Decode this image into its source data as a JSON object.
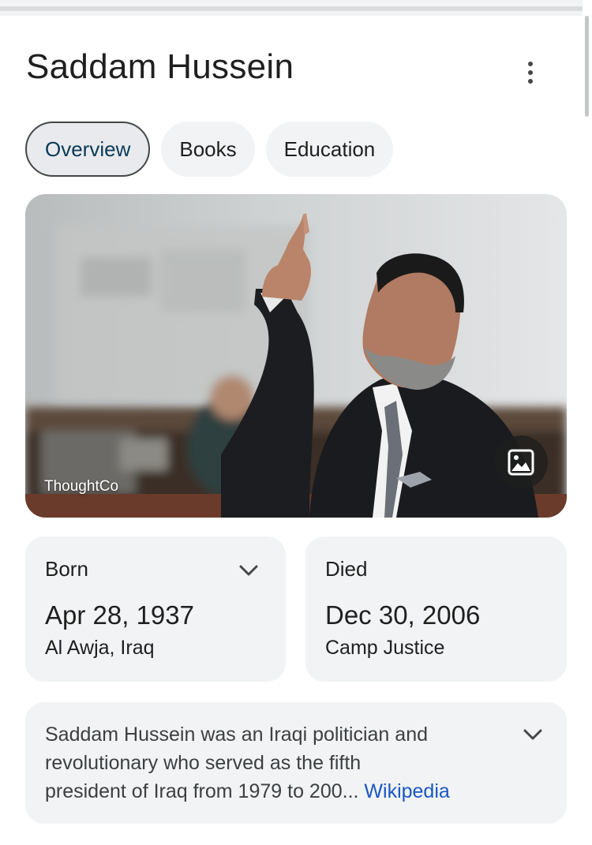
{
  "header": {
    "title": "Saddam Hussein"
  },
  "tabs": [
    {
      "label": "Overview",
      "active": true
    },
    {
      "label": "Books",
      "active": false
    },
    {
      "label": "Education",
      "active": false
    }
  ],
  "hero_image": {
    "credit": "ThoughtCo",
    "icon": "image-icon"
  },
  "facts": {
    "born": {
      "label": "Born",
      "date": "Apr 28, 1937",
      "place": "Al Awja, Iraq",
      "icon": "chevron-down-icon"
    },
    "died": {
      "label": "Died",
      "date": "Dec 30, 2006",
      "place": "Camp Justice"
    }
  },
  "summary": {
    "line1": "Saddam Hussein was an Iraqi politician and",
    "line2": "revolutionary who served as the fifth",
    "line3": "president of Iraq from 1979 to 200",
    "ellipsis": "...",
    "source_link": "Wikipedia"
  },
  "colors": {
    "accent_link": "#1a56c4",
    "card_bg": "#f1f3f4",
    "active_tab_border": "#444746"
  }
}
